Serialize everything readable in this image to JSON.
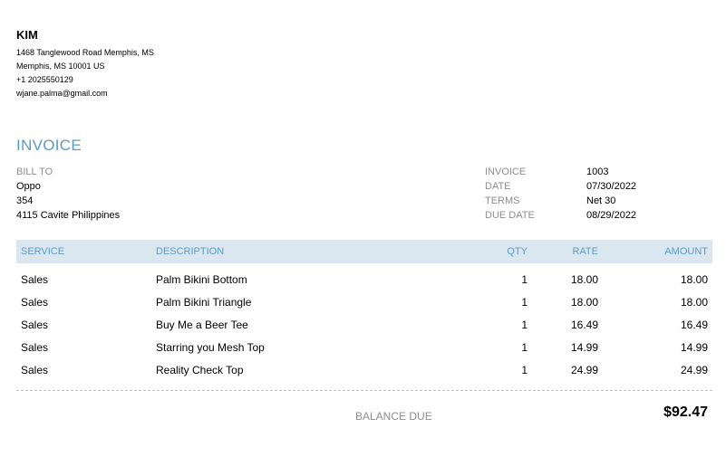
{
  "company": {
    "name": "KIM",
    "address_line1": "1468 Tanglewood Road Memphis,  MS",
    "address_line2": "Memphis,  MS  10001 US",
    "phone": "+1 2025550129",
    "email": "wjane.palma@gmail.com"
  },
  "invoice_title": "INVOICE",
  "bill_to": {
    "label": "BILL TO",
    "name": "Oppo",
    "line1": "354",
    "line2": "4115 Cavite Philippines"
  },
  "meta": [
    {
      "label": "INVOICE",
      "value": "1003"
    },
    {
      "label": "DATE",
      "value": "07/30/2022"
    },
    {
      "label": "TERMS",
      "value": "Net 30"
    },
    {
      "label": "DUE DATE",
      "value": "08/29/2022"
    }
  ],
  "table": {
    "headers": {
      "service": "SERVICE",
      "description": "DESCRIPTION",
      "qty": "QTY",
      "rate": "RATE",
      "amount": "AMOUNT"
    },
    "rows": [
      {
        "service": "Sales",
        "description": "Palm Bikini Bottom",
        "qty": "1",
        "rate": "18.00",
        "amount": "18.00"
      },
      {
        "service": "Sales",
        "description": "Palm Bikini Triangle",
        "qty": "1",
        "rate": "18.00",
        "amount": "18.00"
      },
      {
        "service": "Sales",
        "description": "Buy Me a Beer Tee",
        "qty": "1",
        "rate": "16.49",
        "amount": "16.49"
      },
      {
        "service": "Sales",
        "description": "Starring you Mesh Top",
        "qty": "1",
        "rate": "14.99",
        "amount": "14.99"
      },
      {
        "service": "Sales",
        "description": "Reality Check Top",
        "qty": "1",
        "rate": "24.99",
        "amount": "24.99"
      }
    ]
  },
  "balance": {
    "label": "BALANCE DUE",
    "value": "$92.47"
  },
  "colors": {
    "accent": "#5a9bc4",
    "header_bg": "#dae7f1",
    "label_grey": "#8d8d8d"
  }
}
